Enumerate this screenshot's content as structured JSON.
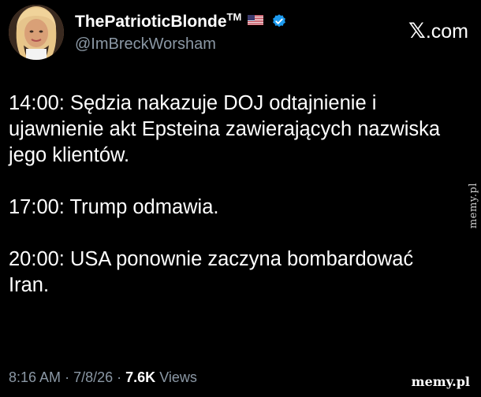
{
  "author": {
    "display_name": "ThePatrioticBlonde",
    "trademark": "TM",
    "handle": "@ImBreckWorsham"
  },
  "brand": {
    "x_glyph": "𝕏",
    "domain": ".com"
  },
  "tweet": {
    "paragraphs": [
      "14:00: Sędzia nakazuje DOJ odtajnienie i ujawnienie akt Epsteina zawierających nazwiska jego klientów.",
      "17:00: Trump odmawia.",
      "20:00: USA ponownie zaczyna bombardować Iran."
    ]
  },
  "meta": {
    "time": "8:16 AM",
    "separator": "·",
    "date": "7/8/26",
    "views_count": "7.6K",
    "views_label": "Views"
  },
  "watermarks": {
    "side": "memy.pl",
    "bottom": "memy.pl"
  },
  "colors": {
    "background": "#000000",
    "text": "#ffffff",
    "muted": "#8b98a5",
    "verified_badge": "#1d9bf0"
  },
  "icons": [
    "avatar-photo",
    "us-flag-icon",
    "verified-badge-icon",
    "x-logo-icon"
  ]
}
